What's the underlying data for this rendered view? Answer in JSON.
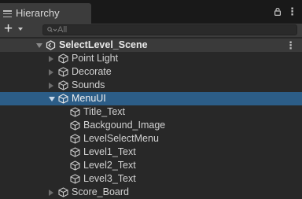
{
  "tab": {
    "title": "Hierarchy",
    "menu_icon": "hamburger-icon",
    "lock_icon": "lock-icon",
    "more_icon": "kebab-icon"
  },
  "toolbar": {
    "add_label": "+",
    "search_placeholder": "All"
  },
  "scene": {
    "name": "SelectLevel_Scene",
    "more": "⋮"
  },
  "tree": {
    "items": [
      {
        "name": "Point Light"
      },
      {
        "name": "Decorate"
      },
      {
        "name": "Sounds"
      },
      {
        "name": "MenuUI"
      },
      {
        "name": "Title_Text"
      },
      {
        "name": "Backgound_Image"
      },
      {
        "name": "LevelSelectMenu"
      },
      {
        "name": "Level1_Text"
      },
      {
        "name": "Level2_Text"
      },
      {
        "name": "Level3_Text"
      },
      {
        "name": "Score_Board"
      }
    ]
  },
  "colors": {
    "selection": "#2c5d87",
    "background": "#282828",
    "tab_bg": "#3c3c3c"
  }
}
